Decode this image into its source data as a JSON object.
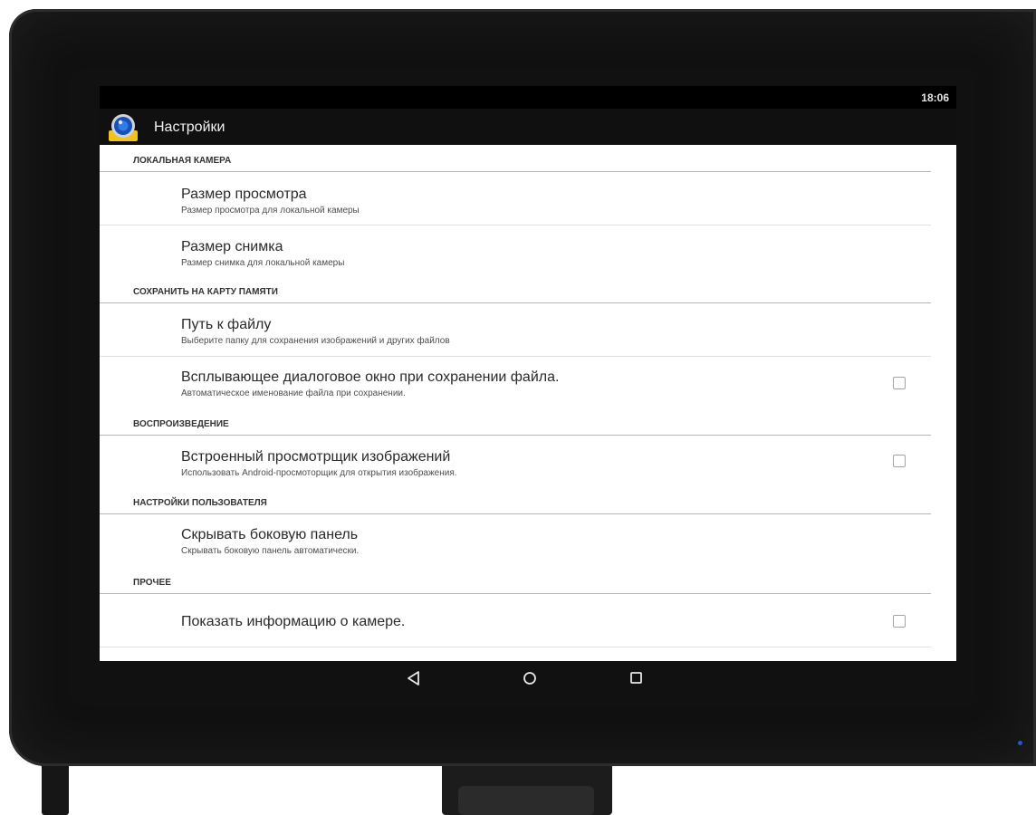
{
  "status_bar": {
    "time": "18:06"
  },
  "action_bar": {
    "title": "Настройки",
    "app_icon": "camera-app-icon"
  },
  "sections": [
    {
      "header": "ЛОКАЛЬНАЯ КАМЕРА",
      "items": [
        {
          "title": "Размер просмотра",
          "summary": "Размер просмотра для локальной камеры",
          "checkbox": false
        },
        {
          "title": "Размер снимка",
          "summary": "Размер снимка для локальной камеры",
          "checkbox": false
        }
      ]
    },
    {
      "header": "СОХРАНИТЬ НА КАРТУ ПАМЯТИ",
      "items": [
        {
          "title": "Путь к файлу",
          "summary": "Выберите папку для сохранения изображений и других файлов",
          "checkbox": false
        },
        {
          "title": "Всплывающее диалоговое окно при сохранении файла.",
          "summary": "Автоматическое именование файла при сохранении.",
          "checkbox": true,
          "checked": false
        }
      ]
    },
    {
      "header": "ВОСПРОИЗВЕДЕНИЕ",
      "items": [
        {
          "title": "Встроенный просмотрщик изображений",
          "summary": "Использовать Android-просмоторщик для открытия изображения.",
          "checkbox": true,
          "checked": false
        }
      ]
    },
    {
      "header": "НАСТРОЙКИ ПОЛЬЗОВАТЕЛЯ",
      "items": [
        {
          "title": "Скрывать боковую панель",
          "summary": "Скрывать боковую панель автоматически.",
          "checkbox": false
        }
      ]
    },
    {
      "header": "ПРОЧЕЕ",
      "items": [
        {
          "title": "Показать информацию о камере.",
          "summary": "",
          "checkbox": true,
          "checked": false
        }
      ]
    }
  ],
  "nav_bar": {
    "icons": [
      "back-icon",
      "home-icon",
      "recents-icon"
    ]
  },
  "colors": {
    "status_bar": "#000000",
    "action_bar": "#101010",
    "divider": "#b5b5b5",
    "bezel": "#111111"
  }
}
